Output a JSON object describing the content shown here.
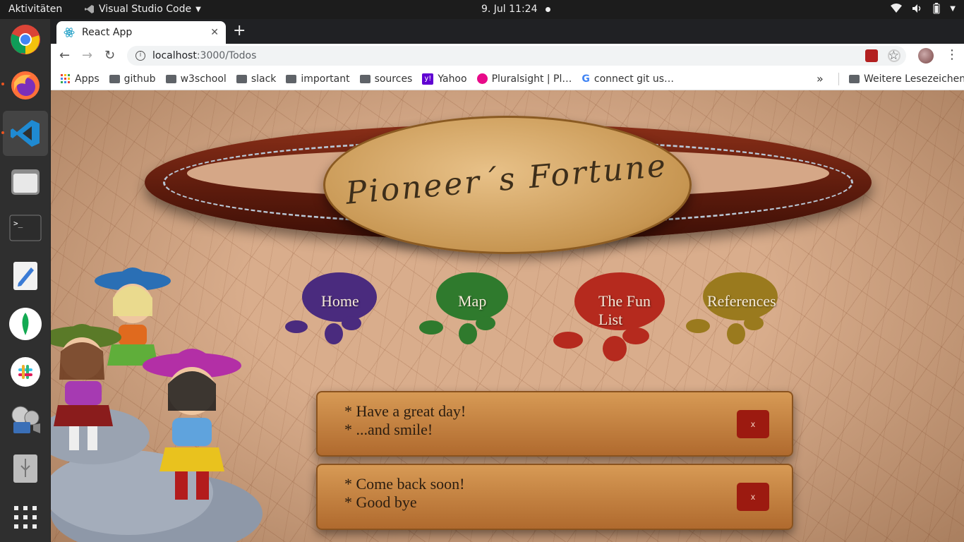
{
  "topbar": {
    "activities": "Aktivitäten",
    "app_name": "Visual Studio Code",
    "clock": "9. Jul  11:24"
  },
  "dock": {
    "items": [
      "chrome-icon",
      "firefox-icon",
      "vscode-icon",
      "files-icon",
      "terminal-icon",
      "text-editor-icon",
      "mongodb-icon",
      "slack-icon",
      "video-icon",
      "usb-icon",
      "app-grid-icon"
    ]
  },
  "browser": {
    "tab_title": "React App",
    "url_host": "localhost",
    "url_path": ":3000/Todos",
    "bookmarks": [
      "Apps",
      "github",
      "w3school",
      "slack",
      "important",
      "sources",
      "Yahoo",
      "Pluralsight | Pl…",
      "connect git us…"
    ],
    "more_bookmarks": "Weitere Lesezeichen",
    "overflow": "»"
  },
  "page": {
    "title": "Pioneer´s Fortune",
    "nav": {
      "home": "Home",
      "map": "Map",
      "fun_list": "The Fun List",
      "references": "References"
    },
    "todos": [
      {
        "line1": "* Have a great day!",
        "line2": "* ...and smile!",
        "delete": "x"
      },
      {
        "line1": "* Come back soon!",
        "line2": "* Good bye",
        "delete": "x"
      }
    ]
  },
  "colors": {
    "accent_home": "#4a2b7e",
    "accent_map": "#2f7a2d",
    "accent_fun": "#b52a1e",
    "accent_ref": "#9a7a1e",
    "delete_btn": "#9c1a10"
  }
}
